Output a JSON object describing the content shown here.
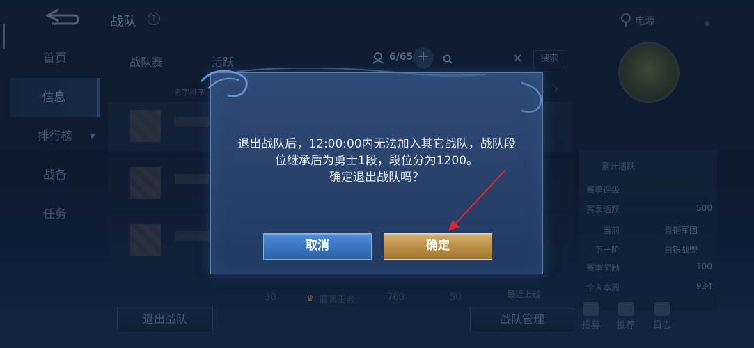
{
  "topbar": {
    "title": "战队",
    "help_glyph": "?",
    "power_label": "电源"
  },
  "nav": {
    "items": [
      {
        "label": "首页"
      },
      {
        "label": "信息"
      },
      {
        "label": "排行榜"
      },
      {
        "label": "战备"
      },
      {
        "label": "任务"
      }
    ],
    "dropdown_glyph": "▼"
  },
  "panel": {
    "tabs": [
      "战队赛",
      "活跃"
    ],
    "member_count": "6/65",
    "add_glyph": "+",
    "clear_glyph": "✕",
    "search_label": "搜索",
    "sort_label": "名字排序",
    "row_arrow": "›"
  },
  "bottom_row": {
    "level": "30",
    "rank": "最强王者",
    "score": "760",
    "activity": "50",
    "last_online": "最近上线"
  },
  "actions": {
    "leave_team": "退出战队",
    "manage_team": "战队管理"
  },
  "stats": {
    "items": [
      {
        "label": "累计活跃",
        "value": ""
      },
      {
        "label": "赛季评级",
        "value": ""
      },
      {
        "label": "赛季活跃",
        "value": "500"
      },
      {
        "label": "当前",
        "value": "青铜军团"
      },
      {
        "label": "下一阶",
        "value": "白银战盟"
      },
      {
        "label": "赛季奖励",
        "value": "100"
      },
      {
        "label": "个人本周",
        "value": "934"
      }
    ]
  },
  "right_buttons": [
    "招募",
    "推荐",
    "日志"
  ],
  "dialog": {
    "message_lines": [
      "退出战队后，12:00:00内无法加入其它战队，战队段",
      "位继承后为勇士1段，段位分为1200。",
      "确定退出战队吗？"
    ],
    "cancel_label": "取消",
    "confirm_label": "确定"
  },
  "colors": {
    "cancel": "#3b76bf",
    "confirm": "#b98d45",
    "annotation_arrow": "#e0262a"
  }
}
